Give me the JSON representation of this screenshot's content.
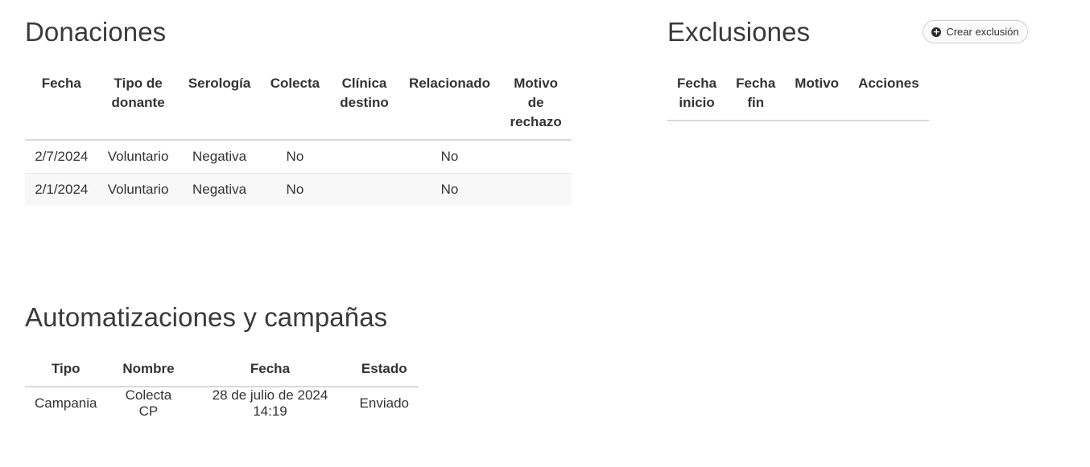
{
  "donaciones": {
    "title": "Donaciones",
    "headers": [
      "Fecha",
      "Tipo de\ndonante",
      "Serología",
      "Colecta",
      "Clínica\ndestino",
      "Relacionado",
      "Motivo\nde\nrechazo"
    ],
    "rows": [
      [
        "2/7/2024",
        "Voluntario",
        "Negativa",
        "No",
        "",
        "No",
        ""
      ],
      [
        "2/1/2024",
        "Voluntario",
        "Negativa",
        "No",
        "",
        "No",
        ""
      ]
    ]
  },
  "exclusiones": {
    "title": "Exclusiones",
    "create_button": {
      "icon": "plus-circle-icon",
      "label": "Crear exclusión"
    },
    "headers": [
      "Fecha\ninicio",
      "Fecha\nfin",
      "Motivo",
      "Acciones"
    ],
    "rows": []
  },
  "automatizaciones": {
    "title": "Automatizaciones y campañas",
    "headers": [
      "Tipo",
      "Nombre",
      "Fecha",
      "Estado"
    ],
    "rows": [
      [
        "Campania",
        "Colecta CP",
        "28 de julio de 2024 14:19",
        "Enviado"
      ]
    ]
  }
}
